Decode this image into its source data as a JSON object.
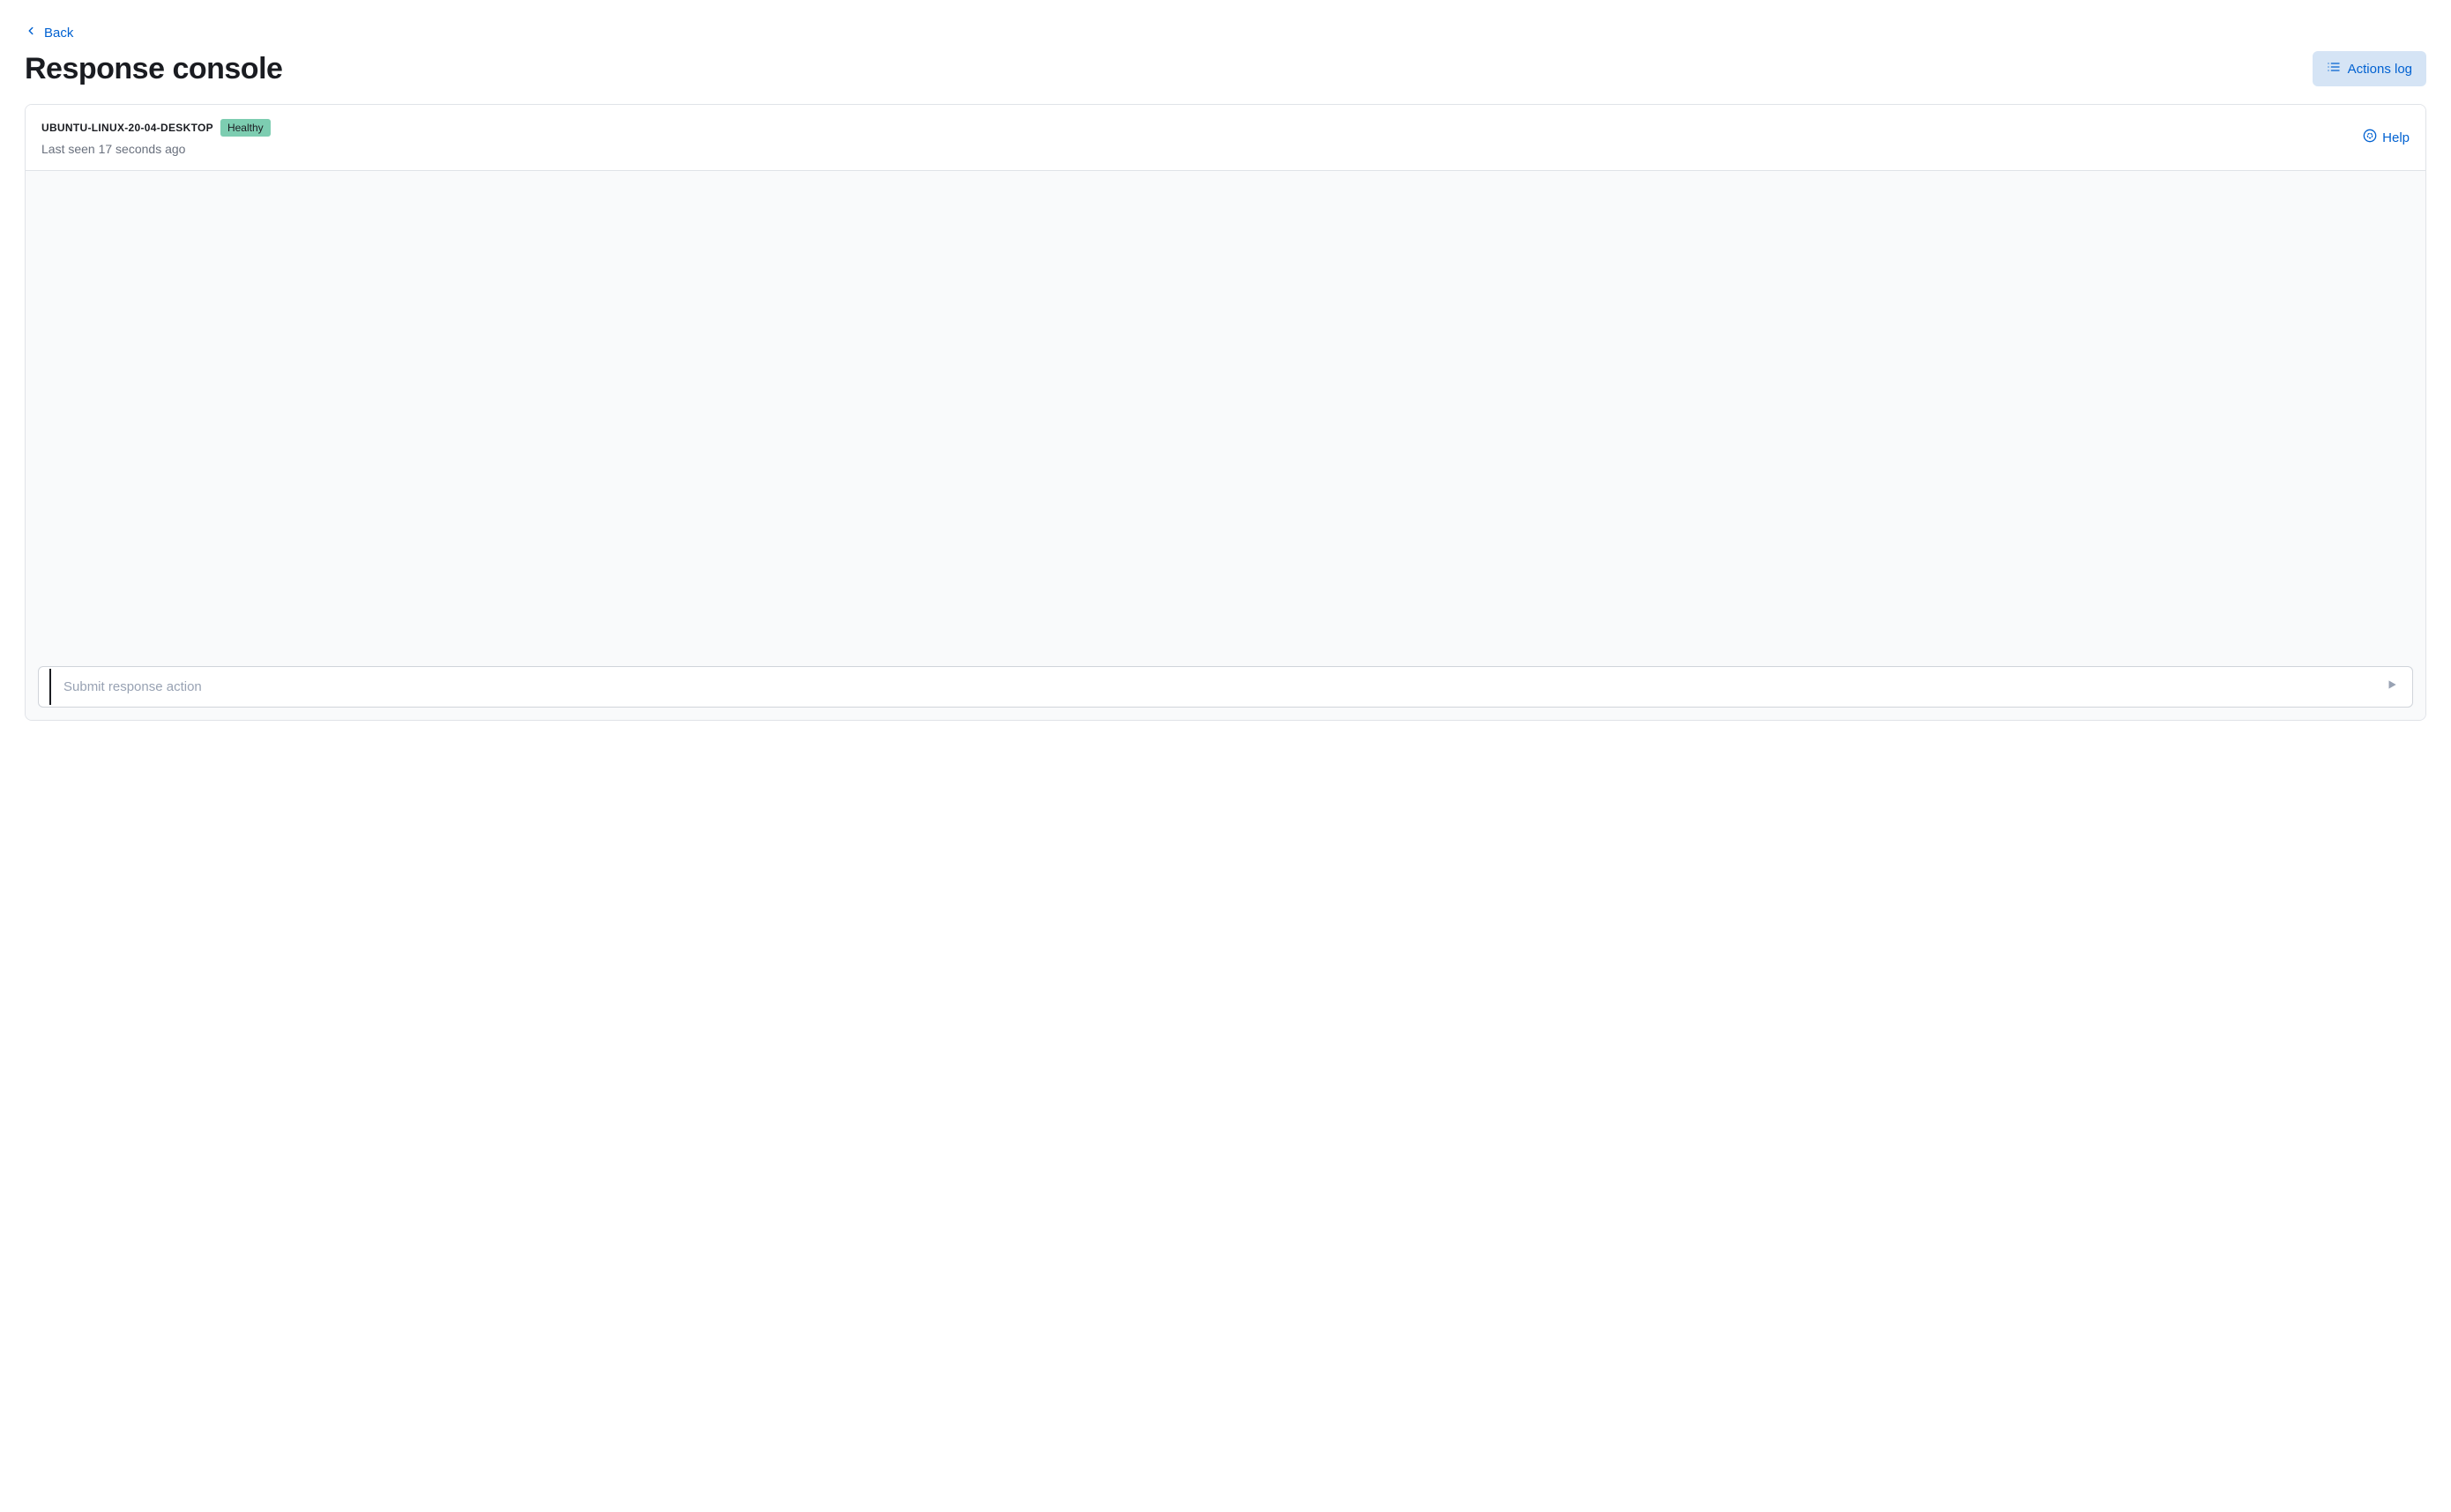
{
  "nav": {
    "back_label": "Back"
  },
  "header": {
    "title": "Response console",
    "actions_log_label": "Actions log"
  },
  "panel": {
    "host_name": "UBUNTU-LINUX-20-04-DESKTOP",
    "status": "Healthy",
    "last_seen": "Last seen 17 seconds ago",
    "help_label": "Help"
  },
  "input": {
    "placeholder": "Submit response action"
  },
  "colors": {
    "accent": "#0061d1",
    "status_healthy_bg": "#7dcdb1",
    "actions_log_bg": "#d5e4f5"
  }
}
